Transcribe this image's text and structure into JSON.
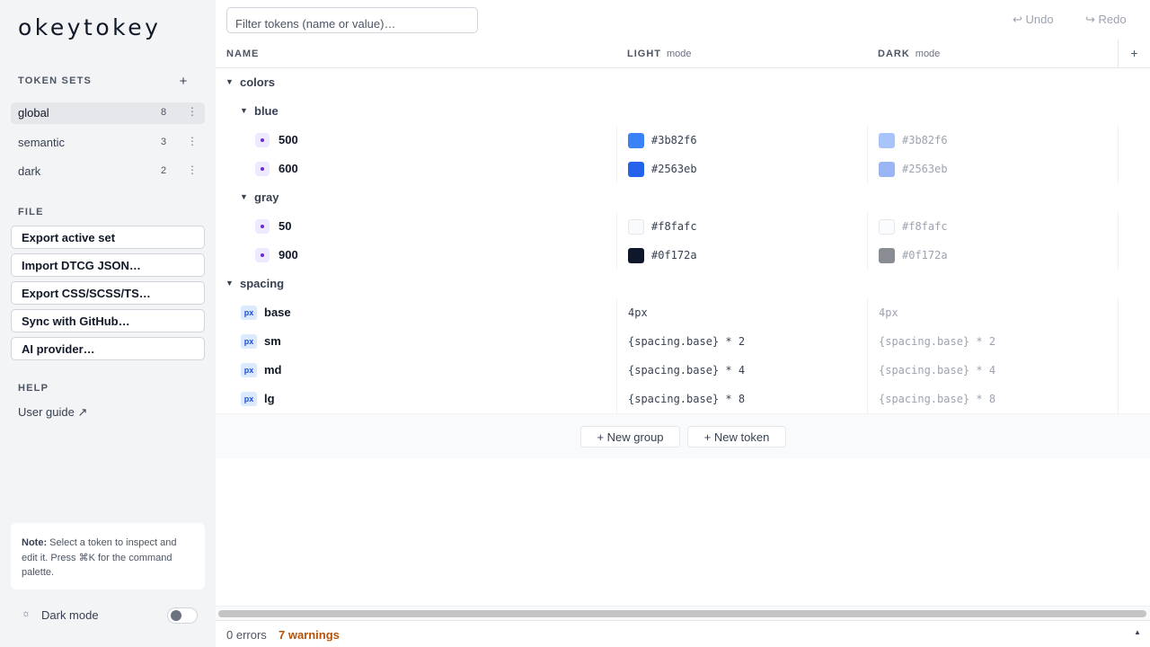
{
  "app": {
    "logo": "okeytokey"
  },
  "sidebar": {
    "token_sets_label": "TOKEN SETS",
    "add_set": "+",
    "sets": [
      {
        "name": "global",
        "count": "8",
        "menu": "⋮"
      },
      {
        "name": "semantic",
        "count": "3",
        "menu": "⋮"
      },
      {
        "name": "dark",
        "count": "2",
        "menu": "⋮"
      }
    ],
    "file_label": "FILE",
    "file_buttons": [
      "Export active set",
      "Import DTCG JSON…",
      "Export CSS/SCSS/TS…",
      "Sync with GitHub…",
      "AI provider…"
    ],
    "help_label": "HELP",
    "user_guide": "User guide ↗",
    "note_title": "Note:",
    "note_text": "Select a token to inspect and edit it. Press ⌘K for the command palette.",
    "dark_mode_icon": "☼",
    "dark_mode_label": "Dark mode",
    "dark_mode_on": false
  },
  "toolbar": {
    "filter_placeholder": "Filter tokens (name or value)…",
    "undo": "↩ Undo",
    "redo": "↪ Redo"
  },
  "table": {
    "col_name": "NAME",
    "col_light": "LIGHT",
    "col_light_sub": "mode",
    "col_dark": "DARK",
    "col_dark_sub": "mode",
    "add_mode": "+",
    "groups": {
      "colors": "colors",
      "blue": "blue",
      "gray": "gray",
      "spacing": "spacing"
    },
    "caret": "▼",
    "color_tokens": [
      {
        "name": "500",
        "light": "#3b82f6",
        "dark": "#3b82f6",
        "light_color": "#3b82f6",
        "dark_color": "#a8c4fa"
      },
      {
        "name": "600",
        "light": "#2563eb",
        "dark": "#2563eb",
        "light_color": "#2563eb",
        "dark_color": "#9ab4f4"
      },
      {
        "name": "50",
        "light": "#f8fafc",
        "dark": "#f8fafc",
        "light_color": "#f8fafc",
        "dark_color": "#fbfcfd"
      },
      {
        "name": "900",
        "light": "#0f172a",
        "dark": "#0f172a",
        "light_color": "#0f172a",
        "dark_color": "#8a8c93"
      }
    ],
    "px_badge": "px",
    "spacing_tokens": [
      {
        "name": "base",
        "light": "4px",
        "dark": "4px"
      },
      {
        "name": "sm",
        "light": "{spacing.base} * 2",
        "dark": "{spacing.base} * 2"
      },
      {
        "name": "md",
        "light": "{spacing.base} * 4",
        "dark": "{spacing.base} * 4"
      },
      {
        "name": "lg",
        "light": "{spacing.base} * 8",
        "dark": "{spacing.base} * 8"
      }
    ],
    "new_group": "+ New group",
    "new_token": "+ New token"
  },
  "footer": {
    "errors": "0 errors",
    "warnings": "7 warnings",
    "expand": "▲"
  }
}
